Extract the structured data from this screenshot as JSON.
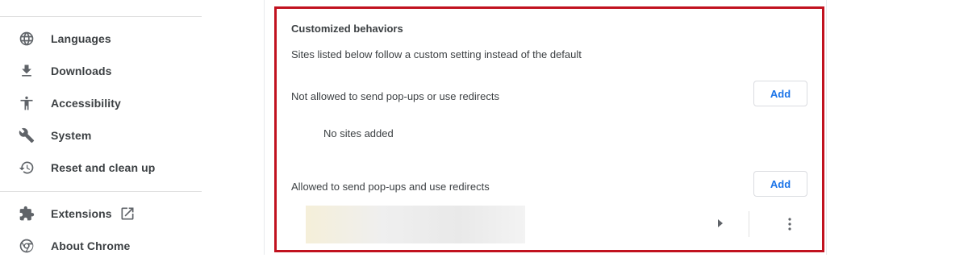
{
  "sidebar": {
    "items": [
      {
        "label": "Languages",
        "icon": "globe-icon"
      },
      {
        "label": "Downloads",
        "icon": "download-icon"
      },
      {
        "label": "Accessibility",
        "icon": "accessibility-icon"
      },
      {
        "label": "System",
        "icon": "wrench-icon"
      },
      {
        "label": "Reset and clean up",
        "icon": "history-icon"
      },
      {
        "label": "Extensions",
        "icon": "puzzle-icon",
        "trailing_icon": "open-in-new-icon"
      },
      {
        "label": "About Chrome",
        "icon": "chrome-icon"
      }
    ]
  },
  "main": {
    "section_title": "Customized behaviors",
    "section_description": "Sites listed below follow a custom setting instead of the default",
    "blocked": {
      "label": "Not allowed to send pop-ups or use redirects",
      "add_label": "Add",
      "empty_text": "No sites added"
    },
    "allowed": {
      "label": "Allowed to send pop-ups and use redirects",
      "add_label": "Add",
      "site_icons": [
        "arrow-right-icon",
        "more-vert-icon"
      ]
    }
  },
  "colors": {
    "accent": "#1a73e8",
    "highlight_border": "#c1121f",
    "icon": "#5f6368",
    "text": "#3c4043"
  }
}
